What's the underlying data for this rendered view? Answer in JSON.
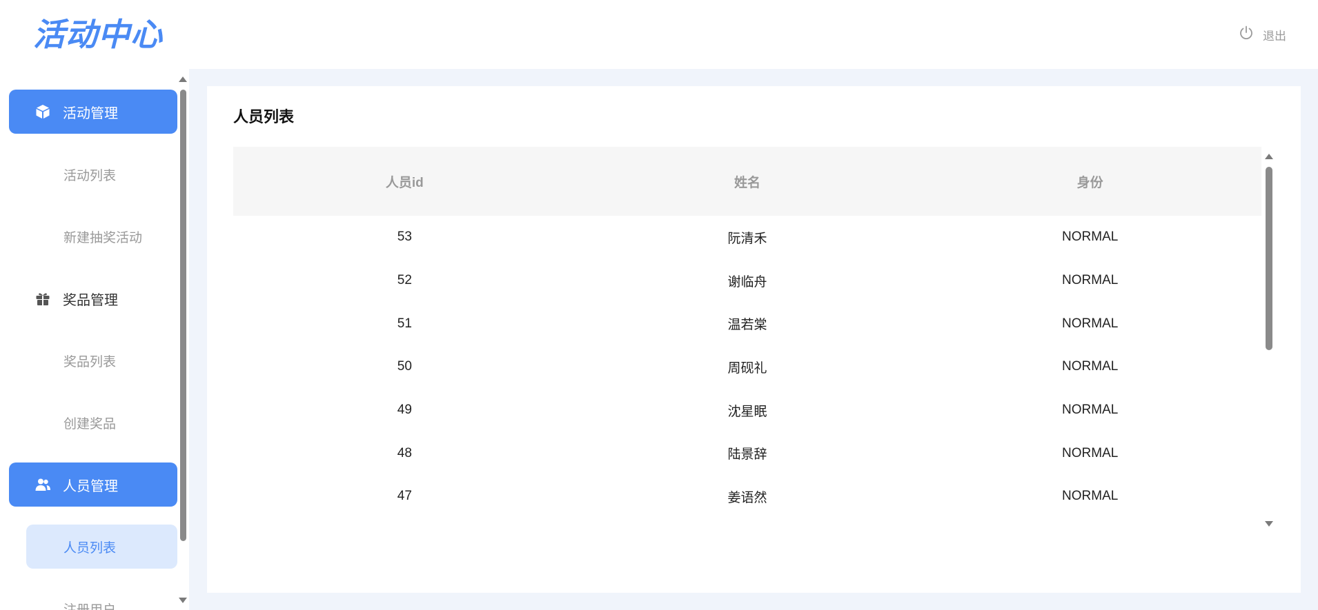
{
  "header": {
    "logo_text": "活动中心",
    "logout_label": "退出",
    "accent_color": "#4a8af4"
  },
  "sidebar": {
    "groups": [
      {
        "label": "活动管理",
        "icon": "cube-icon",
        "active": true,
        "items": [
          {
            "label": "活动列表"
          },
          {
            "label": "新建抽奖活动"
          }
        ]
      },
      {
        "label": "奖品管理",
        "icon": "gift-icon",
        "active": false,
        "items": [
          {
            "label": "奖品列表"
          },
          {
            "label": "创建奖品"
          }
        ]
      },
      {
        "label": "人员管理",
        "icon": "users-icon",
        "active": true,
        "items": [
          {
            "label": "人员列表",
            "active": true
          },
          {
            "label": "注册用户"
          }
        ]
      }
    ]
  },
  "main": {
    "title": "人员列表",
    "columns": [
      "人员id",
      "姓名",
      "身份"
    ],
    "rows": [
      [
        "53",
        "阮清禾",
        "NORMAL"
      ],
      [
        "52",
        "谢临舟",
        "NORMAL"
      ],
      [
        "51",
        "温若棠",
        "NORMAL"
      ],
      [
        "50",
        "周砚礼",
        "NORMAL"
      ],
      [
        "49",
        "沈星眠",
        "NORMAL"
      ],
      [
        "48",
        "陆景辞",
        "NORMAL"
      ],
      [
        "47",
        "姜语然",
        "NORMAL"
      ]
    ]
  }
}
